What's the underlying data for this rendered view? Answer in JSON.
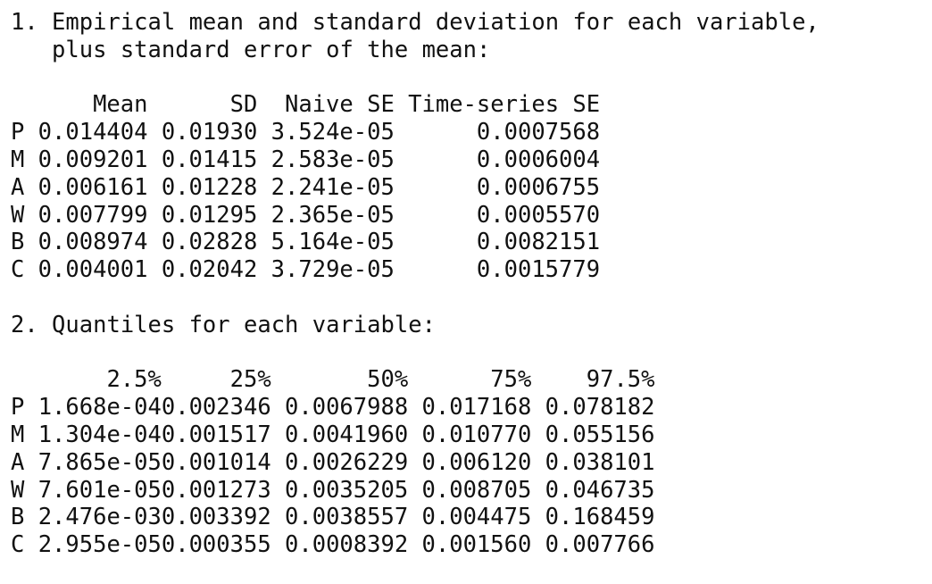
{
  "section1": {
    "heading_line1": "1. Empirical mean and standard deviation for each variable,",
    "heading_line2": "   plus standard error of the mean:",
    "columns": [
      "Mean",
      "SD",
      "Naive SE",
      "Time-series SE"
    ],
    "rows": [
      {
        "name": "P",
        "mean": "0.014404",
        "sd": "0.01930",
        "naive": "3.524e-05",
        "ts": "0.0007568"
      },
      {
        "name": "M",
        "mean": "0.009201",
        "sd": "0.01415",
        "naive": "2.583e-05",
        "ts": "0.0006004"
      },
      {
        "name": "A",
        "mean": "0.006161",
        "sd": "0.01228",
        "naive": "2.241e-05",
        "ts": "0.0006755"
      },
      {
        "name": "W",
        "mean": "0.007799",
        "sd": "0.01295",
        "naive": "2.365e-05",
        "ts": "0.0005570"
      },
      {
        "name": "B",
        "mean": "0.008974",
        "sd": "0.02828",
        "naive": "5.164e-05",
        "ts": "0.0082151"
      },
      {
        "name": "C",
        "mean": "0.004001",
        "sd": "0.02042",
        "naive": "3.729e-05",
        "ts": "0.0015779"
      }
    ]
  },
  "section2": {
    "heading": "2. Quantiles for each variable:",
    "columns": [
      "2.5%",
      "25%",
      "50%",
      "75%",
      "97.5%"
    ],
    "rows": [
      {
        "name": "P",
        "values": [
          "1.668e-04",
          "0.002346",
          "0.0067988",
          "0.017168",
          "0.078182"
        ]
      },
      {
        "name": "M",
        "values": [
          "1.304e-04",
          "0.001517",
          "0.0041960",
          "0.010770",
          "0.055156"
        ]
      },
      {
        "name": "A",
        "values": [
          "7.865e-05",
          "0.001014",
          "0.0026229",
          "0.006120",
          "0.038101"
        ]
      },
      {
        "name": "W",
        "values": [
          "7.601e-05",
          "0.001273",
          "0.0035205",
          "0.008705",
          "0.046735"
        ]
      },
      {
        "name": "B",
        "values": [
          "2.476e-03",
          "0.003392",
          "0.0038557",
          "0.004475",
          "0.168459"
        ]
      },
      {
        "name": "C",
        "values": [
          "2.955e-05",
          "0.000355",
          "0.0008392",
          "0.001560",
          "0.007766"
        ]
      }
    ]
  }
}
